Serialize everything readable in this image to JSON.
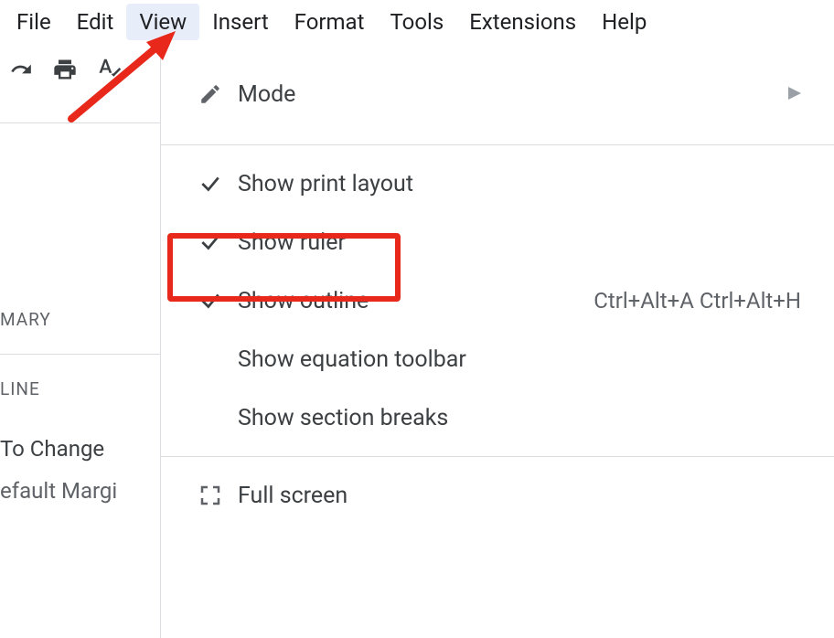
{
  "menubar": {
    "items": [
      {
        "label": "File"
      },
      {
        "label": "Edit"
      },
      {
        "label": "View"
      },
      {
        "label": "Insert"
      },
      {
        "label": "Format"
      },
      {
        "label": "Tools"
      },
      {
        "label": "Extensions"
      },
      {
        "label": "Help"
      }
    ]
  },
  "left_panel": {
    "summary_label": "MARY",
    "outline_label": "LINE",
    "doc_title_fragment": "To Change",
    "doc_sub_fragment": "efault Margi"
  },
  "view_menu": {
    "mode_label": "Mode",
    "items": {
      "print_layout": "Show print layout",
      "ruler": "Show ruler",
      "outline": "Show outline",
      "outline_shortcut": "Ctrl+Alt+A Ctrl+Alt+H",
      "equation_toolbar": "Show equation toolbar",
      "section_breaks": "Show section breaks",
      "full_screen": "Full screen"
    }
  }
}
